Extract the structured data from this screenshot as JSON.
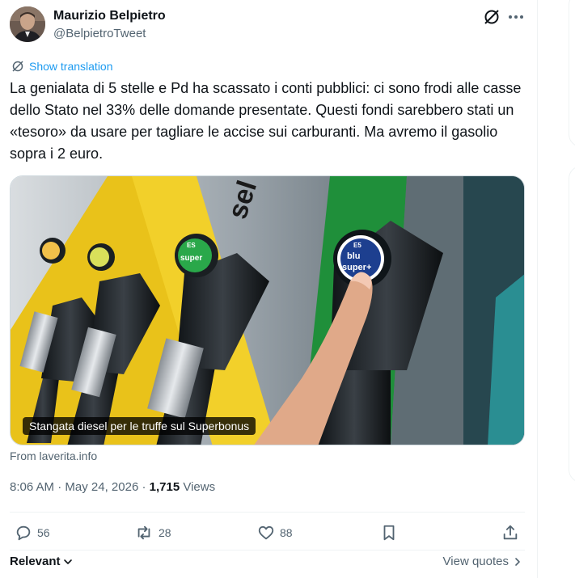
{
  "author": {
    "name": "Maurizio Belpietro",
    "handle": "@BelpietroTweet"
  },
  "translate_label": "Show translation",
  "tweet_text": "La genialata di 5 stelle e Pd ha scassato i conti pubblici: ci sono frodi alle casse dello Stato nel 33% delle domande presentate. Questi fondi sarebbero stati un «tesoro» da usare per tagliare le accise sui carburanti. Ma avremo il gasolio sopra i 2 euro.",
  "media": {
    "caption": "Stangata diesel per le truffe sul Superbonus",
    "pump_labels": [
      "sel",
      "super",
      "blu",
      "super+",
      "ES",
      "E5"
    ]
  },
  "source": "From laverita.info",
  "meta": {
    "time": "8:06 AM",
    "sep": "·",
    "date": "May 24, 2026",
    "views_count": "1,715",
    "views_label": "Views"
  },
  "actions": {
    "replies": "56",
    "reposts": "28",
    "likes": "88"
  },
  "footer": {
    "sort": "Relevant",
    "quotes": "View quotes"
  },
  "colors": {
    "accent": "#1d9bf0",
    "text": "#0f1419",
    "muted": "#536471",
    "border": "#eff3f4"
  }
}
